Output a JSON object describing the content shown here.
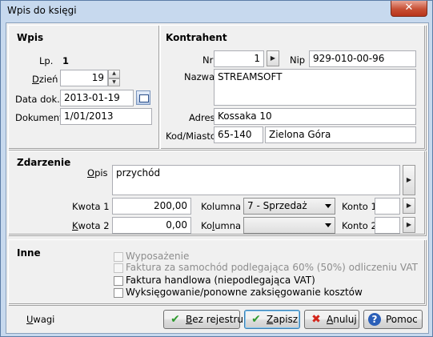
{
  "window": {
    "title": "Wpis do księgi",
    "close_label": "✕"
  },
  "wpis": {
    "group": "Wpis",
    "lp_label": "Lp.",
    "lp_value": "1",
    "dzien_label": "Dzień",
    "dzien_value": "19",
    "data_dok_label": "Data dok.",
    "data_dok_value": "2013-01-19",
    "dokument_label": "Dokument",
    "dokument_value": "1/01/2013"
  },
  "kontrahent": {
    "group": "Kontrahent",
    "nr_label": "Nr",
    "nr_value": "1",
    "nip_label": "Nip",
    "nip_value": "929-010-00-96",
    "nazwa_label": "Nazwa",
    "nazwa_value": "STREAMSOFT",
    "adres_label": "Adres",
    "adres_value": "Kossaka 10",
    "kod_label": "Kod/Miasto",
    "kod_value": "65-140",
    "miasto_value": "Zielona Góra"
  },
  "zdarzenie": {
    "group": "Zdarzenie",
    "opis_label": "Opis",
    "opis_value": "przychód",
    "kwota1_label": "Kwota 1",
    "kwota1_value": "200,00",
    "kwota2_label": "Kwota 2",
    "kwota2_value": "0,00",
    "kolumna1_label": "Kolumna 1",
    "kolumna1_value": "7 - Sprzedaż",
    "kolumna2_label": "Kolumna 2",
    "kolumna2_value": "",
    "konto1_label": "Konto 1",
    "konto1_value": "",
    "konto2_label": "Konto 2",
    "konto2_value": ""
  },
  "inne": {
    "group": "Inne",
    "options": [
      {
        "label": "Wyposażenie",
        "checked": false,
        "enabled": false
      },
      {
        "label": "Faktura za samochód podlegająca 60% (50%) odliczeniu VAT",
        "checked": false,
        "enabled": false
      },
      {
        "label": "Faktura handlowa (niepodlegająca VAT)",
        "checked": false,
        "enabled": true
      },
      {
        "label": "Wyksięgowanie/ponowne zaksięgowanie kosztów",
        "checked": false,
        "enabled": true
      }
    ]
  },
  "footer": {
    "uwagi": "Uwagi",
    "bez_rejestru": "Bez rejestru",
    "zapisz": "Zapisz",
    "anuluj": "Anuluj",
    "pomoc": "Pomoc"
  }
}
